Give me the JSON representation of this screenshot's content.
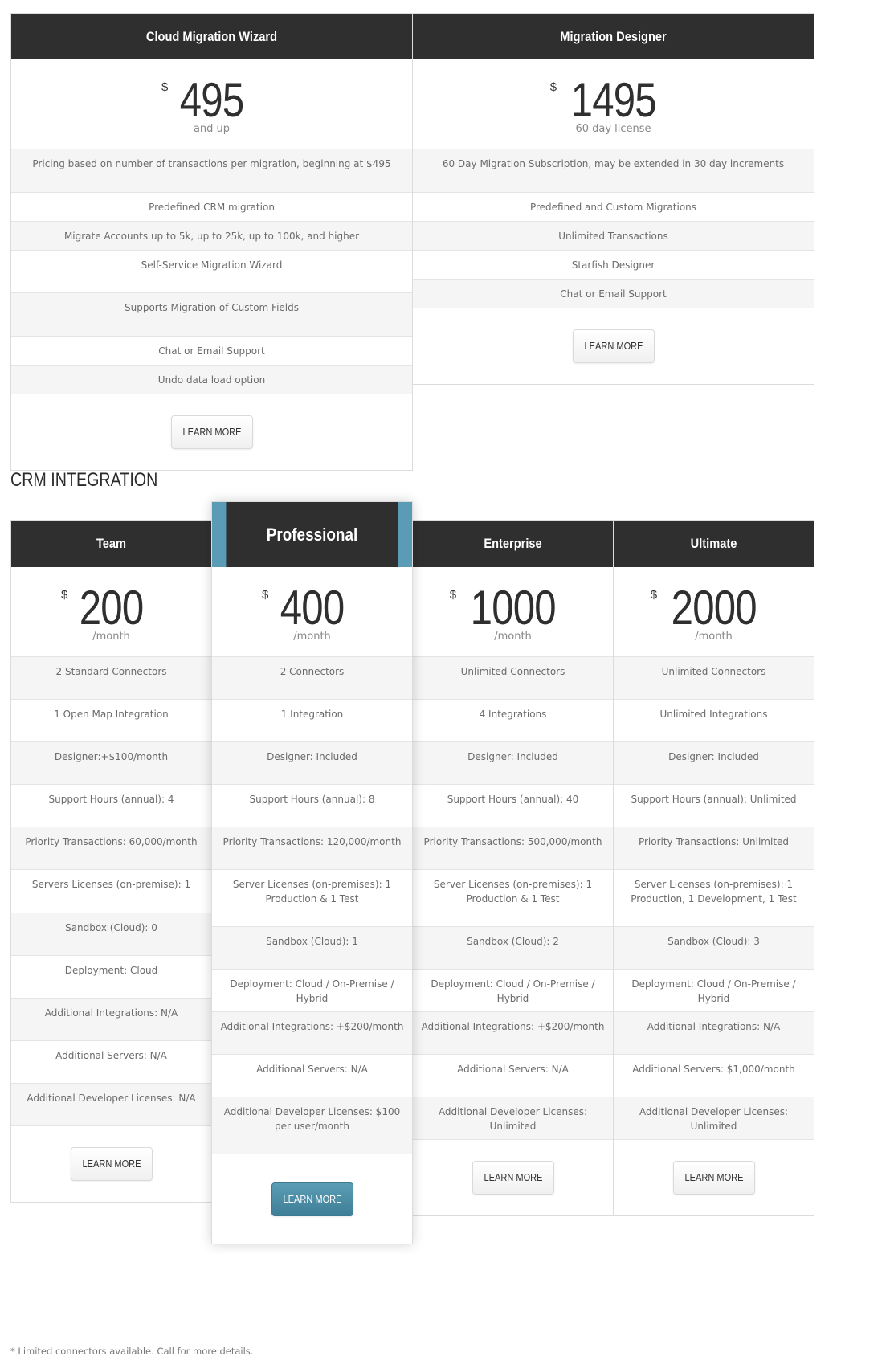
{
  "migration": {
    "plans": [
      {
        "name": "Cloud Migration Wizard",
        "currency": "$",
        "price": "495",
        "period": "and up",
        "features": [
          "Pricing based on number of transactions per migration, beginning at $495",
          "Predefined CRM migration",
          "Migrate Accounts up to 5k, up to 25k, up to 100k, and higher",
          "Self-Service Migration Wizard",
          "Supports Migration of Custom Fields",
          "Chat or Email Support",
          "Undo data load option"
        ],
        "button": "LEARN MORE"
      },
      {
        "name": "Migration Designer",
        "currency": "$",
        "price": "1495",
        "period": "60 day license",
        "features": [
          "60 Day Migration Subscription, may be extended in 30 day increments",
          "Predefined and Custom Migrations",
          "Unlimited Transactions",
          "Starfish Designer",
          "Chat or Email Support"
        ],
        "button": "LEARN MORE"
      }
    ]
  },
  "crm": {
    "section_title": "CRM INTEGRATION",
    "plans": [
      {
        "name": "Team",
        "currency": "$",
        "price": "200",
        "period": "/month",
        "features": [
          "2 Standard Connectors",
          "1 Open Map Integration",
          "Designer:+$100/month",
          "Support Hours (annual): 4",
          "Priority Transactions: 60,000/month",
          "Servers Licenses (on-premise): 1",
          "Sandbox (Cloud): 0",
          "Deployment: Cloud",
          "Additional Integrations: N/A",
          "Additional Servers: N/A",
          "Additional Developer Licenses: N/A"
        ],
        "button": "LEARN MORE"
      },
      {
        "name": "Professional",
        "featured": true,
        "currency": "$",
        "price": "400",
        "period": "/month",
        "features": [
          "2 Connectors",
          "1 Integration",
          "Designer: Included",
          "Support Hours (annual): 8",
          "Priority Transactions: 120,000/month",
          "Server Licenses (on-premises): 1 Production & 1 Test",
          "Sandbox (Cloud): 1",
          "Deployment: Cloud / On-Premise / Hybrid",
          "Additional Integrations: +$200/month",
          "Additional Servers: N/A",
          "Additional Developer Licenses: $100 per user/month"
        ],
        "button": "LEARN MORE"
      },
      {
        "name": "Enterprise",
        "currency": "$",
        "price": "1000",
        "period": "/month",
        "features": [
          "Unlimited Connectors",
          "4 Integrations",
          "Designer: Included",
          "Support Hours (annual): 40",
          "Priority Transactions: 500,000/month",
          "Server Licenses (on-premises): 1 Production & 1 Test",
          "Sandbox (Cloud): 2",
          "Deployment: Cloud / On-Premise / Hybrid",
          "Additional Integrations: +$200/month",
          "Additional Servers: N/A",
          "Additional Developer Licenses: Unlimited"
        ],
        "button": "LEARN MORE"
      },
      {
        "name": "Ultimate",
        "currency": "$",
        "price": "2000",
        "period": "/month",
        "features": [
          "Unlimited Connectors",
          "Unlimited Integrations",
          "Designer: Included",
          "Support Hours (annual): Unlimited",
          "Priority Transactions: Unlimited",
          "Server Licenses (on-premises): 1 Production, 1 Development, 1 Test",
          "Sandbox (Cloud): 3",
          "Deployment: Cloud / On-Premise / Hybrid",
          "Additional Integrations: N/A",
          "Additional Servers: $1,000/month",
          "Additional Developer Licenses: Unlimited"
        ],
        "button": "LEARN MORE"
      }
    ]
  },
  "footnote": "* Limited connectors available.  Call for more details.",
  "colors": {
    "header_dark": "#2f2f2f",
    "featured_accent": "#5a9bb5",
    "alt_row": "#f5f5f5"
  }
}
